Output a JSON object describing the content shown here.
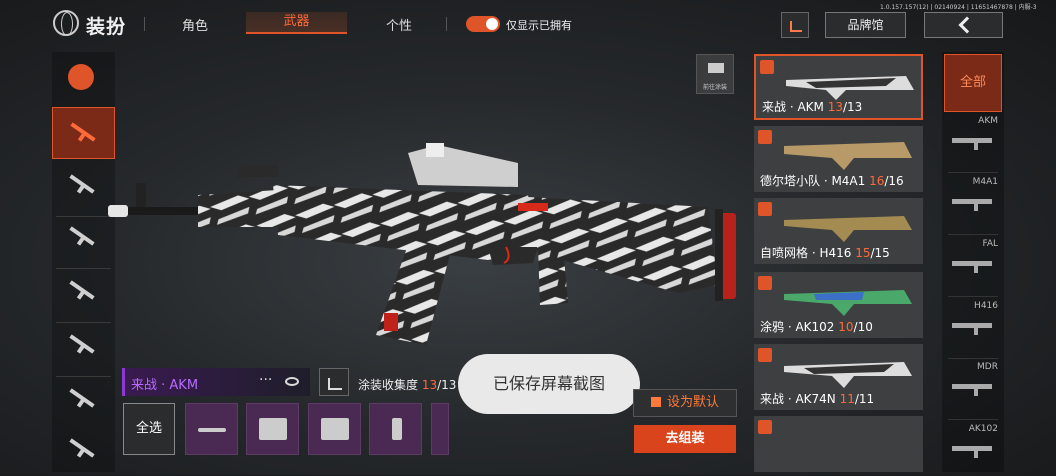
{
  "header": {
    "title": "装扮",
    "tabs": [
      {
        "label": "角色",
        "active": false
      },
      {
        "label": "武器",
        "active": true
      },
      {
        "label": "个性",
        "active": false
      }
    ],
    "toggle_label": "仅显示已拥有",
    "toggle_on": true,
    "version": "1.0.157.157(12) | 02140924 | 11651467878 | 内服-3",
    "brand_button": "品牌馆"
  },
  "sidebar": {
    "items": [
      {
        "icon": "skin-category-icon",
        "active": false
      },
      {
        "icon": "rifle-icon",
        "active": true
      },
      {
        "icon": "smg-icon",
        "active": false
      },
      {
        "icon": "sniper-icon",
        "active": false
      },
      {
        "icon": "shotgun-icon",
        "active": false
      },
      {
        "icon": "lmg-icon",
        "active": false
      },
      {
        "icon": "marksman-icon",
        "active": false
      },
      {
        "icon": "pistol-icon",
        "active": false
      }
    ]
  },
  "preview": {
    "spray_label": "前往涂装"
  },
  "skins": [
    {
      "prefix": "来战 · AKM ",
      "owned": "13",
      "total": "/13",
      "active": true
    },
    {
      "prefix": "德尔塔小队 · M4A1 ",
      "owned": "16",
      "total": "/16",
      "active": false
    },
    {
      "prefix": "自喷网格 · H416 ",
      "owned": "15",
      "total": "/15",
      "active": false
    },
    {
      "prefix": "涂鸦 · AK102 ",
      "owned": "10",
      "total": "/10",
      "active": false
    },
    {
      "prefix": "来战 · AK74N ",
      "owned": "11",
      "total": "/11",
      "active": false
    }
  ],
  "rail": {
    "all_label": "全部",
    "items": [
      "AKM",
      "M4A1",
      "FAL",
      "H416",
      "MDR",
      "AK102"
    ]
  },
  "bottom": {
    "skin_name": "来战 · AKM",
    "more": "···",
    "collect_label": "涂装收集度 ",
    "collect_owned": "13",
    "collect_total": "/13",
    "select_all": "全选",
    "parts": [
      "barrel-part-icon",
      "stock-part-icon",
      "scope-part-icon",
      "grip-part-icon"
    ]
  },
  "toast": "已保存屏幕截图",
  "buttons": {
    "set_default": "设为默认",
    "go_assemble": "去组装"
  },
  "colors": {
    "accent": "#e0542a",
    "rarity_purple": "#b86aff",
    "toast_bg": "#e9e9e9"
  }
}
